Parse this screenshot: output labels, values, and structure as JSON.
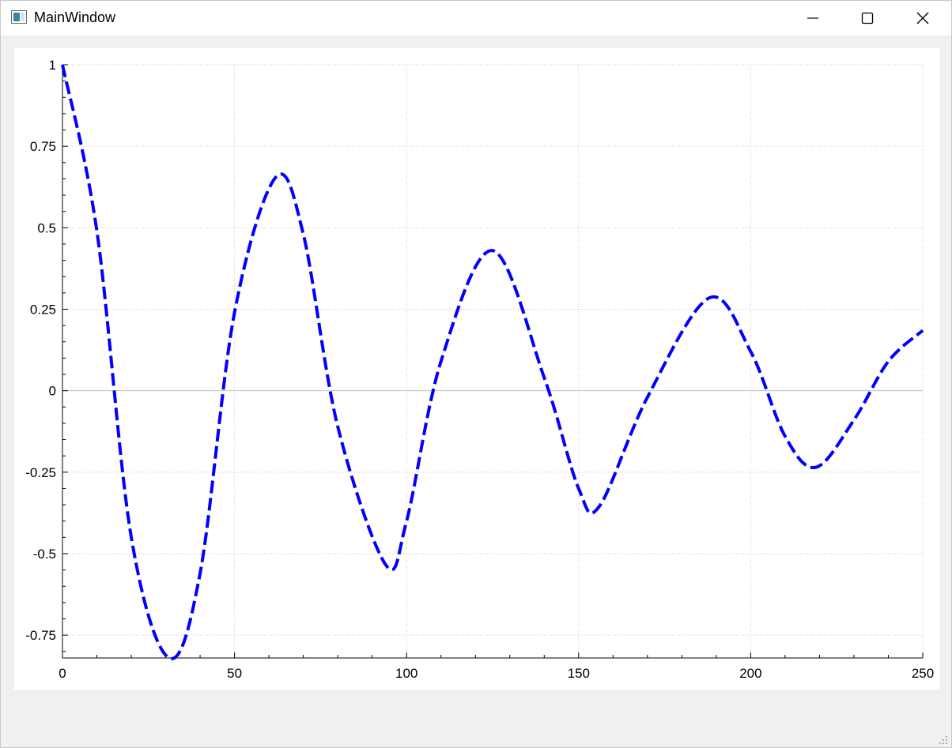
{
  "window": {
    "title": "MainWindow",
    "icons": {
      "app": "app-window-icon",
      "minimize": "minimize-icon",
      "maximize": "maximize-icon",
      "close": "close-icon"
    }
  },
  "chart_data": {
    "type": "line",
    "title": "",
    "xlabel": "",
    "ylabel": "",
    "xlim": [
      0,
      250
    ],
    "ylim": [
      -0.82,
      1
    ],
    "grid": true,
    "x_ticks": [
      0,
      50,
      100,
      150,
      200,
      250
    ],
    "y_ticks": [
      1,
      0.75,
      0.5,
      0.25,
      0,
      -0.25,
      -0.5,
      -0.75
    ],
    "x_tick_labels": [
      "0",
      "50",
      "100",
      "150",
      "200",
      "250"
    ],
    "y_tick_labels": [
      "1",
      "0.75",
      "0.5",
      "0.25",
      "0",
      "-0.25",
      "-0.5",
      "-0.75"
    ],
    "series": [
      {
        "color": "#0000ff",
        "line_style": "dashed",
        "x": [
          0,
          10,
          20,
          31,
          40,
          50,
          62,
          70,
          80,
          94,
          100,
          110,
          125,
          140,
          150,
          156,
          170,
          188,
          200,
          210,
          219,
          230,
          240,
          250
        ],
        "y": [
          1.0,
          0.49,
          -0.45,
          -0.82,
          -0.56,
          0.24,
          0.655,
          0.48,
          -0.11,
          -0.535,
          -0.4,
          0.09,
          0.43,
          0.04,
          -0.3,
          -0.355,
          -0.02,
          0.285,
          0.12,
          -0.14,
          -0.235,
          -0.09,
          0.09,
          0.185
        ]
      }
    ]
  }
}
